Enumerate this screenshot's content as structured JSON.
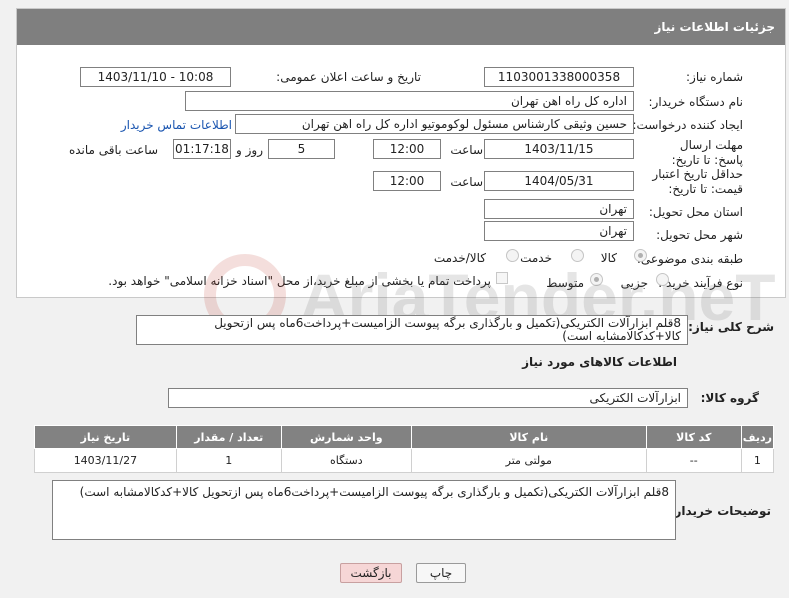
{
  "header": {
    "title": "جزئیات اطلاعات نیاز"
  },
  "form": {
    "need_number_label": "شماره نیاز:",
    "need_number": "1103001338000358",
    "announce_label": "تاریخ و ساعت اعلان عمومی:",
    "announce_value": "1403/11/10 - 10:08",
    "buyer_org_label": "نام دستگاه خریدار:",
    "buyer_org": "اداره کل راه اهن تهران",
    "creator_label": "ایجاد کننده درخواست:",
    "creator": "حسین وثیقی کارشناس مسئول لوکوموتیو اداره کل راه اهن تهران",
    "contact_link": "اطلاعات تماس خریدار",
    "deadline_label": "مهلت ارسال پاسخ: تا تاریخ:",
    "deadline_date": "1403/11/15",
    "time_label": "ساعت",
    "deadline_time": "12:00",
    "days_value": "5",
    "days_label": "روز و",
    "remaining_time": "01:17:18",
    "remaining_label": "ساعت باقی مانده",
    "validity_label": "حداقل تاریخ اعتبار قیمت: تا تاریخ:",
    "validity_date": "1404/05/31",
    "validity_time": "12:00",
    "province_label": "استان محل تحویل:",
    "province": "تهران",
    "city_label": "شهر محل تحویل:",
    "city": "تهران",
    "category_label": "طبقه بندی موضوعی:",
    "category_options": [
      "کالا",
      "خدمت",
      "کالا/خدمت"
    ],
    "process_label": "نوع فرآیند خرید :",
    "process_options": [
      "جزیی",
      "متوسط"
    ],
    "payment_note": "پرداخت تمام یا بخشی از مبلغ خرید،از محل \"اسناد خزانه اسلامی\" خواهد بود."
  },
  "summary": {
    "label": "شرح کلی نیاز:",
    "text": "8قلم ابزارآلات الکتریکی(تکمیل و بارگذاری برگه پیوست الزامیست+پرداخت6ماه پس ازتحویل کالا+کدکالامشابه است)"
  },
  "goods": {
    "section_title": "اطلاعات کالاهای مورد نیاز",
    "group_label": "گروه کالا:",
    "group_value": "ابزارآلات الکتریکی"
  },
  "table": {
    "headers": [
      "ردیف",
      "کد کالا",
      "نام کالا",
      "واحد شمارش",
      "تعداد / مقدار",
      "تاریخ نیاز"
    ],
    "rows": [
      [
        "1",
        "--",
        "مولتی متر",
        "دستگاه",
        "1",
        "1403/11/27"
      ]
    ]
  },
  "buyer_notes": {
    "label": "توضیحات خریدار:",
    "text": "8قلم ابزارآلات الکتریکی(تکمیل و بارگذاری برگه پیوست الزامیست+پرداخت6ماه پس ازتحویل کالا+کدکالامشابه است)"
  },
  "buttons": {
    "print": "چاپ",
    "back": "بازگشت"
  },
  "colors": {
    "header": "#7f7f7f",
    "link": "#1a55b0",
    "back_button": "#f6d6d6"
  }
}
